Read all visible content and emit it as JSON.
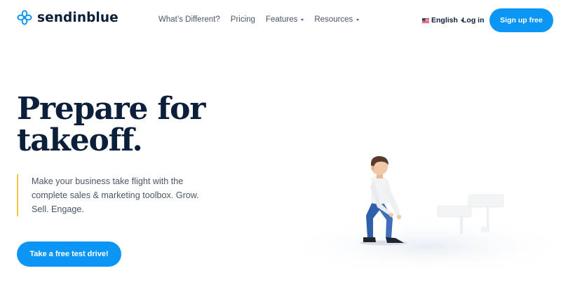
{
  "brand": {
    "name": "sendinblue",
    "accent_color": "#0b96f5",
    "text_color": "#0b1f3a",
    "highlight_color": "#f6c43b"
  },
  "nav": {
    "items": [
      {
        "label": "What’s Different?",
        "dropdown": false
      },
      {
        "label": "Pricing",
        "dropdown": false
      },
      {
        "label": "Features",
        "dropdown": true
      },
      {
        "label": "Resources",
        "dropdown": true
      }
    ]
  },
  "header_actions": {
    "language": "English",
    "language_icon": "us-flag-icon",
    "login": "Log in",
    "signup": "Sign up free"
  },
  "hero": {
    "title": "Prepare for takeoff.",
    "description": "Make your business take flight with the complete sales & marketing toolbox. Grow. Sell. Engage.",
    "cta": "Take a free test drive!"
  }
}
